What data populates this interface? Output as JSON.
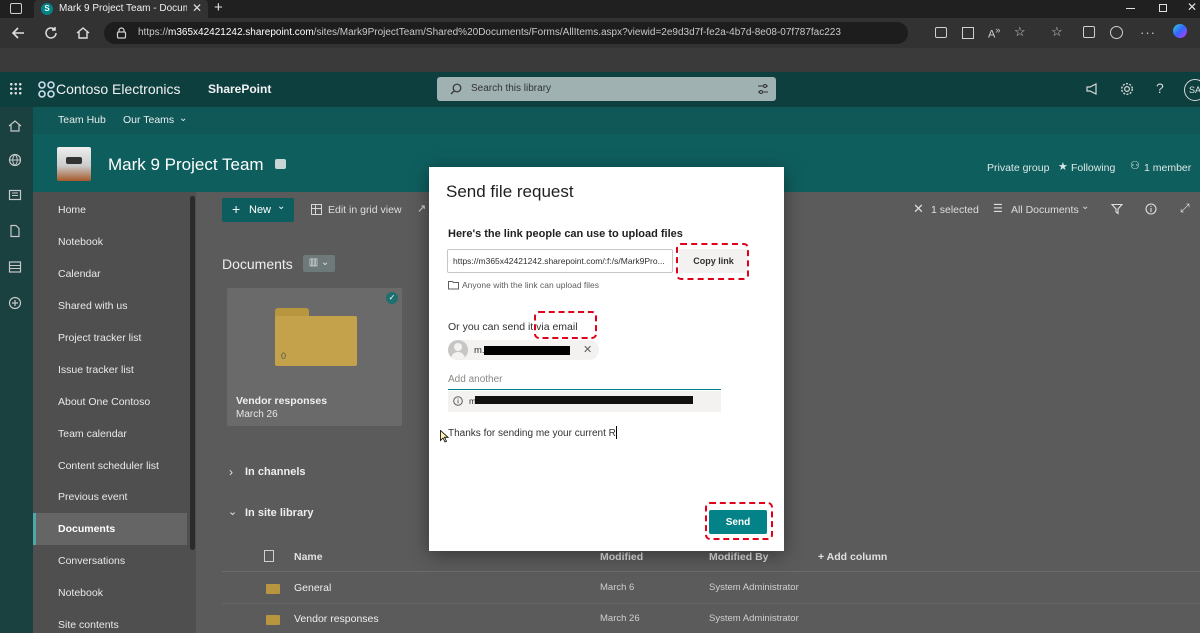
{
  "browser": {
    "tab_title": "Mark 9 Project Team - Documen",
    "url_prefix": "https://",
    "url_host": "m365x42421242.sharepoint.com",
    "url_path": "/sites/Mark9ProjectTeam/Shared%20Documents/Forms/AllItems.aspx?viewid=2e9d3d7f-fe2a-4b7d-8e08-07f787fac223"
  },
  "suite": {
    "org_name": "Contoso Electronics",
    "app_name": "SharePoint",
    "search_placeholder": "Search this library",
    "avatar_initials": "SA"
  },
  "hub_nav": {
    "items": [
      "Team Hub",
      "Our Teams"
    ]
  },
  "site": {
    "title": "Mark 9 Project Team",
    "privacy": "Private group",
    "following": "Following",
    "members": "1 member"
  },
  "left_nav": {
    "items": [
      "Home",
      "Notebook",
      "Calendar",
      "Shared with us",
      "Project tracker list",
      "Issue tracker list",
      "About One Contoso",
      "Team calendar",
      "Content scheduler list",
      "Previous event",
      "Documents",
      "Conversations",
      "Notebook",
      "Site contents"
    ],
    "selected_index": 10
  },
  "command_bar": {
    "new_label": "New",
    "edit_grid_label": "Edit in grid view",
    "selected_count": "1 selected",
    "view_label": "All Documents"
  },
  "library": {
    "title": "Documents",
    "folder_card": {
      "name": "Vendor responses",
      "date": "March 26",
      "count": "0"
    },
    "in_channels": "In channels",
    "in_site_library": "In site library",
    "columns": [
      "Name",
      "Modified",
      "Modified By",
      "Add column"
    ],
    "rows": [
      {
        "name": "General",
        "modified": "March 6",
        "modified_by": "System Administrator"
      },
      {
        "name": "Vendor responses",
        "modified": "March 26",
        "modified_by": "System Administrator"
      }
    ]
  },
  "dialog": {
    "title": "Send file request",
    "link_heading": "Here's the link people can use to upload files",
    "link_value": "https://m365x42421242.sharepoint.com/:f:/s/Mark9Pro...",
    "copy_link_label": "Copy link",
    "anyone_note": "Anyone with the link can upload files",
    "email_intro": "Or you can send it via email",
    "recipient_prefix": "m.",
    "add_another_placeholder": "Add another",
    "info_prefix": "m",
    "message_text": "Thanks for sending me your current R",
    "send_label": "Send"
  },
  "colors": {
    "suite_bar": "#0e3f3f",
    "site_header": "#0f5e5e",
    "accent_teal": "#038387",
    "highlight_red": "#e1001a"
  }
}
